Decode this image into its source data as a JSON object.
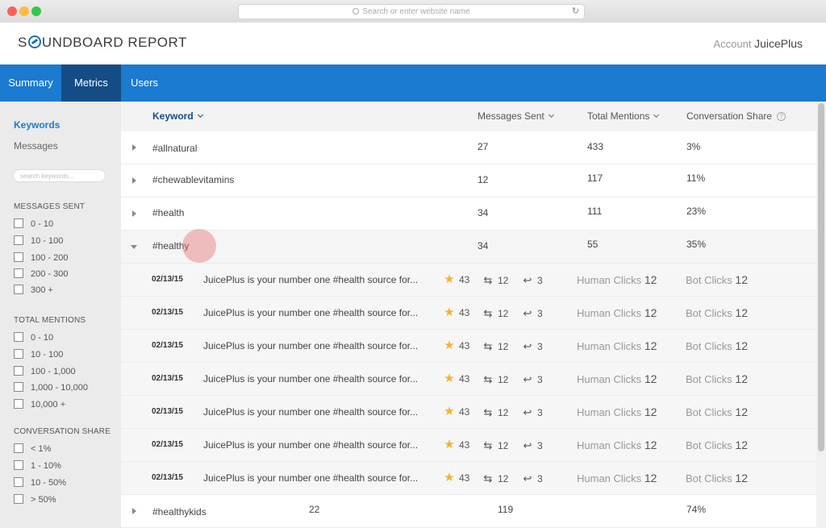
{
  "browser": {
    "url_placeholder": "Search or enter website name"
  },
  "header": {
    "logo_pre": "S",
    "logo_post": "UNDBOARD REPORT",
    "account_label": "Account",
    "account_name": "JuicePlus"
  },
  "nav": {
    "tabs": [
      "Summary",
      "Metrics",
      "Users"
    ]
  },
  "sidebar": {
    "links": [
      "Keywords",
      "Messages"
    ],
    "search_placeholder": "search keywords...",
    "groups": [
      {
        "heading": "MESSAGES SENT",
        "options": [
          "0 - 10",
          "10 - 100",
          "100 - 200",
          "200 - 300",
          "300 +"
        ]
      },
      {
        "heading": "TOTAL MENTIONS",
        "options": [
          "0 - 10",
          "10 - 100",
          "100 - 1,000",
          "1,000 - 10,000",
          "10,000 +"
        ]
      },
      {
        "heading": "CONVERSATION SHARE",
        "options": [
          "< 1%",
          "1 - 10%",
          "10 - 50%",
          "> 50%"
        ]
      }
    ]
  },
  "table": {
    "headers": {
      "keyword": "Keyword",
      "messages": "Messages Sent",
      "mentions": "Total Mentions",
      "share": "Conversation Share",
      "help": "?"
    },
    "rows": [
      {
        "keyword": "#allnatural",
        "messages": "27",
        "mentions": "433",
        "share": "3%"
      },
      {
        "keyword": "#chewablevitamins",
        "messages": "12",
        "mentions": "117",
        "share": "11%"
      },
      {
        "keyword": "#health",
        "messages": "34",
        "mentions": "111",
        "share": "23%"
      },
      {
        "keyword": "#healthy",
        "messages": "34",
        "mentions": "55",
        "share": "35%"
      }
    ],
    "messages": [
      {
        "date": "02/13/15",
        "text": "JuicePlus is your number one #health source for...",
        "favorites": "43",
        "retweets": "12",
        "replies": "3",
        "human_label": "Human Clicks",
        "human": "12",
        "bot_label": "Bot Clicks",
        "bot": "12"
      },
      {
        "date": "02/13/15",
        "text": "JuicePlus is your number one #health source for...",
        "favorites": "43",
        "retweets": "12",
        "replies": "3",
        "human_label": "Human Clicks",
        "human": "12",
        "bot_label": "Bot Clicks",
        "bot": "12"
      },
      {
        "date": "02/13/15",
        "text": "JuicePlus is your number one #health source for...",
        "favorites": "43",
        "retweets": "12",
        "replies": "3",
        "human_label": "Human Clicks",
        "human": "12",
        "bot_label": "Bot Clicks",
        "bot": "12"
      },
      {
        "date": "02/13/15",
        "text": "JuicePlus is your number one #health source for...",
        "favorites": "43",
        "retweets": "12",
        "replies": "3",
        "human_label": "Human Clicks",
        "human": "12",
        "bot_label": "Bot Clicks",
        "bot": "12"
      },
      {
        "date": "02/13/15",
        "text": "JuicePlus is your number one #health source for...",
        "favorites": "43",
        "retweets": "12",
        "replies": "3",
        "human_label": "Human Clicks",
        "human": "12",
        "bot_label": "Bot Clicks",
        "bot": "12"
      },
      {
        "date": "02/13/15",
        "text": "JuicePlus is your number one #health source for...",
        "favorites": "43",
        "retweets": "12",
        "replies": "3",
        "human_label": "Human Clicks",
        "human": "12",
        "bot_label": "Bot Clicks",
        "bot": "12"
      },
      {
        "date": "02/13/15",
        "text": "JuicePlus is your number one #health source for...",
        "favorites": "43",
        "retweets": "12",
        "replies": "3",
        "human_label": "Human Clicks",
        "human": "12",
        "bot_label": "Bot Clicks",
        "bot": "12"
      }
    ],
    "last_row": {
      "keyword": "#healthykids",
      "messages": "22",
      "mentions": "119",
      "share": "74%"
    }
  },
  "colors": {
    "nav": "#1b7bd0",
    "nav_active": "#144d85",
    "star": "#f0b429"
  }
}
